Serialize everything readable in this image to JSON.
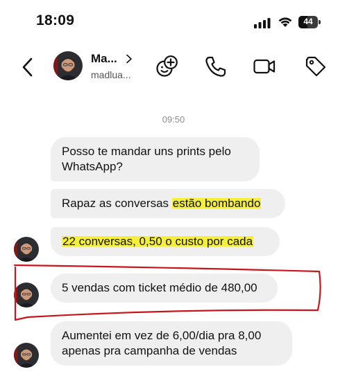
{
  "status_bar": {
    "time": "18:09",
    "battery": "44"
  },
  "header": {
    "name": "Ma...",
    "username": "madlua..."
  },
  "icons": {
    "back": "chevron-left-icon",
    "profile_chevron": "chevron-right-icon",
    "effects": "sticker-smile-plus-icon",
    "call": "phone-icon",
    "video": "video-camera-icon",
    "label": "tag-icon"
  },
  "conversation": {
    "timestamp": "09:50",
    "messages": [
      {
        "text": "Posso te mandar uns prints pelo WhatsApp?"
      },
      {
        "before": "Rapaz as conversas ",
        "highlight": "estão bombando",
        "after": ""
      },
      {
        "before": "",
        "highlight": "22 conversas, 0,50 o custo por cada",
        "after": ""
      },
      {
        "text": "5 vendas com ticket médio de 480,00"
      },
      {
        "text": "Aumentei em vez de 6,00/dia pra 8,00 apenas pra campanha de vendas"
      }
    ]
  },
  "colors": {
    "bubble": "#efefef",
    "highlight": "#f6ef3a",
    "annotation": "#c8151b"
  }
}
